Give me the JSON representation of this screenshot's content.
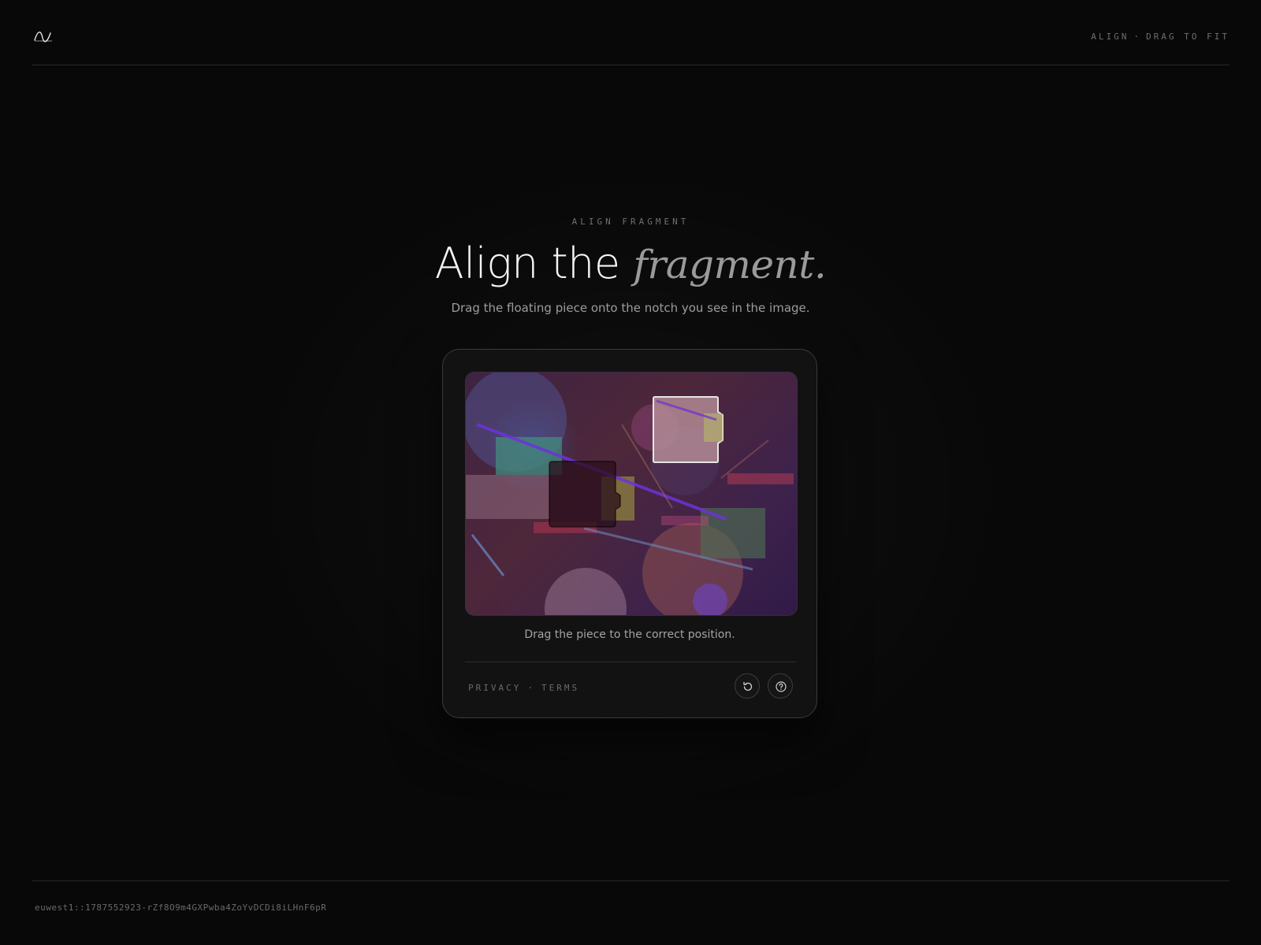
{
  "header": {
    "logo_icon": "wave-logo-icon",
    "right_label_1": "ALIGN",
    "right_sep": "·",
    "right_label_2": "DRAG TO FIT"
  },
  "hero": {
    "eyebrow": "ALIGN FRAGMENT",
    "title_main": "Align the",
    "title_accent": "fragment.",
    "subtitle": "Drag the floating piece onto the notch you see in the image."
  },
  "card": {
    "instruction": "Drag the piece to the correct position.",
    "links": {
      "privacy": "PRIVACY",
      "sep": "·",
      "terms": "TERMS"
    },
    "refresh_icon": "refresh-icon",
    "help_icon": "help-icon"
  },
  "footer": {
    "token": "euwest1::1787552923-rZf8O9m4GXPwba4ZoYvDCDi8iLHnF6pR"
  },
  "colors": {
    "background": "#080808",
    "card_border": "#3a3a3a",
    "accent_text": "#9a9a9a"
  }
}
